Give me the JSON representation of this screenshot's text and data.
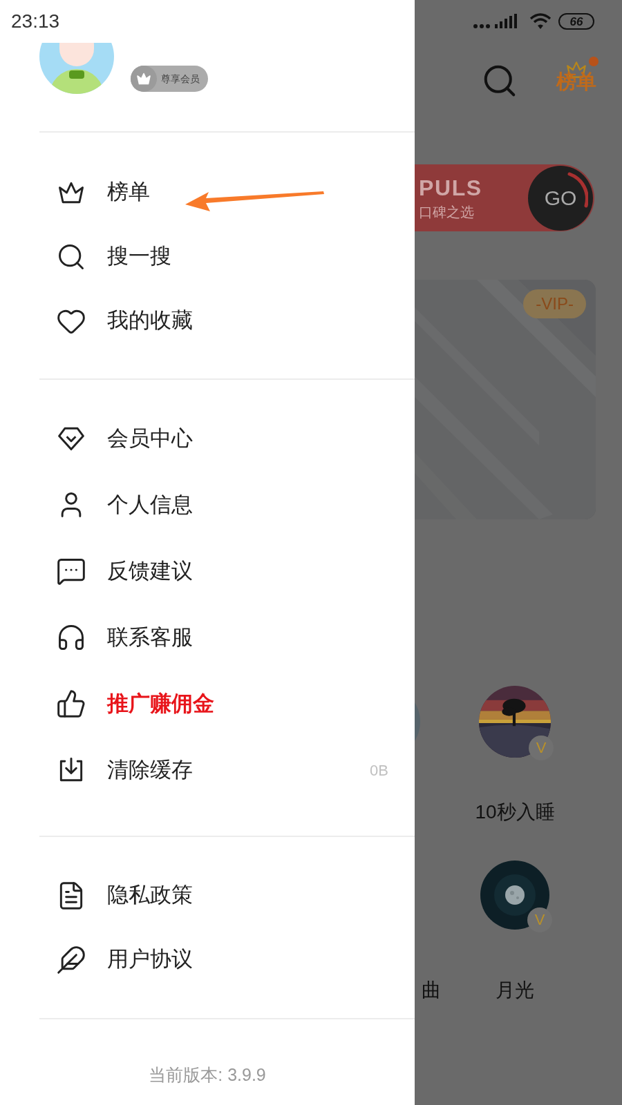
{
  "status_bar": {
    "time": "23:13",
    "battery": "66"
  },
  "profile": {
    "badge": "尊享会员"
  },
  "menu_sections": [
    {
      "items": [
        {
          "label": "榜单",
          "highlighted": false
        },
        {
          "label": "搜一搜",
          "highlighted": false
        },
        {
          "label": "我的收藏",
          "highlighted": false
        }
      ]
    },
    {
      "items": [
        {
          "label": "会员中心",
          "highlighted": false
        },
        {
          "label": "个人信息",
          "highlighted": false
        },
        {
          "label": "反馈建议",
          "highlighted": false
        },
        {
          "label": "联系客服",
          "highlighted": false
        },
        {
          "label": "推广赚佣金",
          "highlighted": true
        },
        {
          "label": "清除缓存",
          "highlighted": false,
          "value": "0B"
        }
      ]
    },
    {
      "items": [
        {
          "label": "隐私政策",
          "highlighted": false
        },
        {
          "label": "用户协议",
          "highlighted": false
        }
      ]
    }
  ],
  "version": "当前版本: 3.9.9",
  "background_app": {
    "header_logo": "榜单",
    "banner": {
      "title": "PULS",
      "subtitle": "口碑之选",
      "button": "GO"
    },
    "vip_card": {
      "badge": "-VIP-"
    },
    "partial_label": "曲",
    "tiles": [
      {
        "label": "10秒入睡",
        "badge": "V"
      },
      {
        "label": "月光",
        "badge": "V"
      }
    ]
  }
}
